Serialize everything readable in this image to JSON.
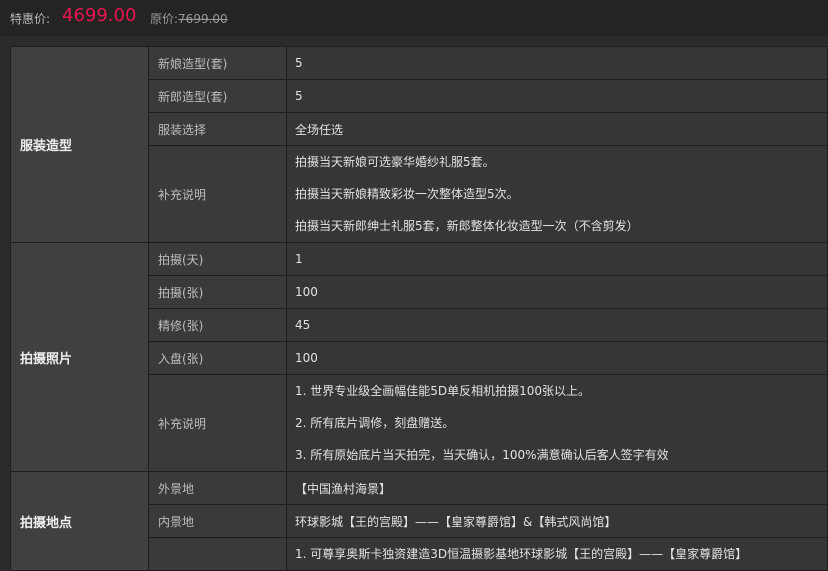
{
  "price": {
    "special_label": "特惠价:",
    "special_value": "4699.00",
    "original_label": "原价:",
    "original_value": "7699.00"
  },
  "groups": {
    "costume": {
      "title": "服装造型",
      "rows": [
        {
          "key": "新娘造型(套)",
          "value": "5"
        },
        {
          "key": "新郎造型(套)",
          "value": "5"
        },
        {
          "key": "服装选择",
          "value": "全场任选"
        }
      ],
      "note_key": "补充说明",
      "notes": [
        "拍摄当天新娘可选豪华婚纱礼服5套。",
        "拍摄当天新娘精致彩妆一次整体造型5次。",
        "拍摄当天新郎绅士礼服5套，新郎整体化妆造型一次（不含剪发）"
      ]
    },
    "photos": {
      "title": "拍摄照片",
      "rows": [
        {
          "key": "拍摄(天)",
          "value": "1"
        },
        {
          "key": "拍摄(张)",
          "value": "100"
        },
        {
          "key": "精修(张)",
          "value": "45"
        },
        {
          "key": "入盘(张)",
          "value": "100"
        }
      ],
      "note_key": "补充说明",
      "notes": [
        "1. 世界专业级全画幅佳能5D单反相机拍摄100张以上。",
        "2. 所有底片调修，刻盘赠送。",
        "3. 所有原始底片当天拍完，当天确认，100%满意确认后客人签字有效"
      ]
    },
    "location": {
      "title": "拍摄地点",
      "rows": [
        {
          "key": "外景地",
          "value": "【中国渔村海景】"
        },
        {
          "key": "内景地",
          "value": "环球影城【王的宫殿】——【皇家尊爵馆】&【韩式风尚馆】"
        }
      ],
      "note_partial": "1.  可尊享奥斯卡独资建造3D恒温摄影基地环球影城【王的宫殿】——【皇家尊爵馆】"
    }
  }
}
